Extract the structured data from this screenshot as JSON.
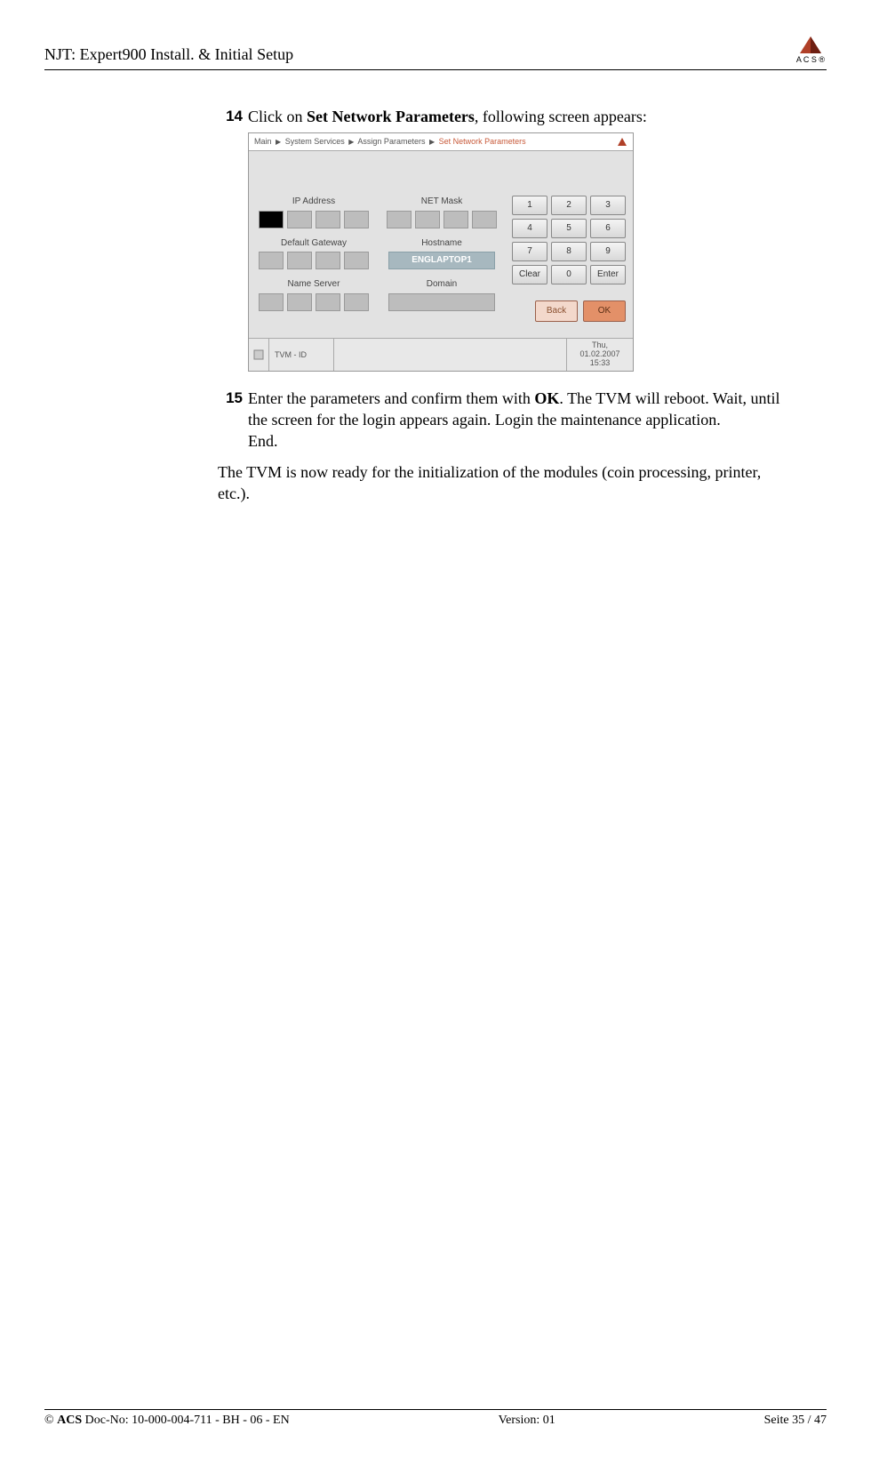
{
  "header": {
    "title": "NJT: Expert900 Install. & Initial Setup",
    "logo_text": "A   C   S ®"
  },
  "steps": {
    "s14": {
      "num": "14",
      "text_pre": "Click on ",
      "bold": "Set Network Parameters",
      "text_post": ", following screen appears:"
    },
    "s15": {
      "num": "15",
      "text_pre": "Enter the parameters and confirm them with ",
      "bold": "OK",
      "text_post": ". The TVM will reboot. Wait, until the screen for the login appears again. Login the maintenance application.",
      "end": "End."
    }
  },
  "paragraph": "The TVM is now ready for the initialization of the modules (coin processing, printer, etc.).",
  "shot": {
    "breadcrumb": {
      "p1": "Main",
      "p2": "System Services",
      "p3": "Assign Parameters",
      "p4": "Set Network Parameters"
    },
    "labels": {
      "ip": "IP Address",
      "mask": "NET Mask",
      "gw": "Default Gateway",
      "host": "Hostname",
      "ns": "Name Server",
      "domain": "Domain"
    },
    "hostname": "ENGLAPTOP1",
    "keypad": [
      "1",
      "2",
      "3",
      "4",
      "5",
      "6",
      "7",
      "8",
      "9",
      "Clear",
      "0",
      "Enter"
    ],
    "back": "Back",
    "ok": "OK",
    "status": {
      "id_label": "TVM - ID",
      "day": "Thu,",
      "date": "01.02.2007",
      "time": "15:33"
    }
  },
  "footer": {
    "copyright_prefix": "© ",
    "acs": "ACS",
    "docno": "  Doc-No: 10-000-004-711 - BH - 06 - EN",
    "version": "Version: 01",
    "page": "Seite 35 / 47"
  }
}
